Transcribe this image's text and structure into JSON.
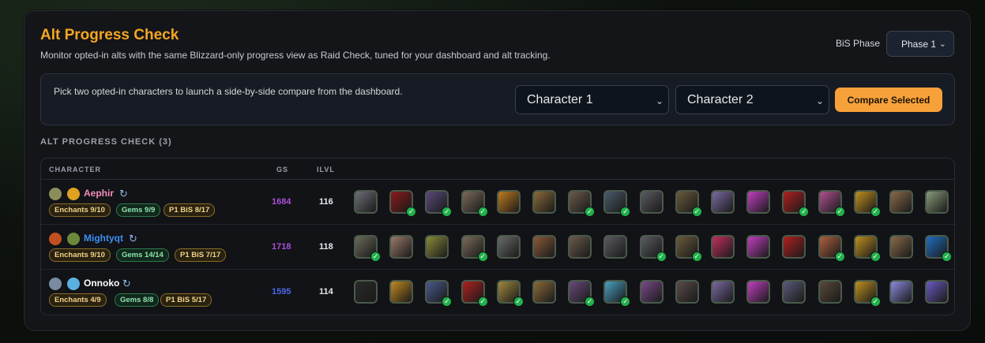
{
  "header": {
    "title": "Alt Progress Check",
    "subtitle": "Monitor opted-in alts with the same Blizzard-only progress view as Raid Check, tuned for your dashboard and alt tracking.",
    "phase_label": "BiS Phase",
    "phase_value": "Phase 1"
  },
  "compare": {
    "text": "Pick two opted-in characters to launch a side-by-side compare from the dashboard.",
    "char1": "Character 1",
    "char2": "Character 2",
    "button": "Compare Selected"
  },
  "section_title": "ALT PROGRESS CHECK (3)",
  "table": {
    "headers": {
      "character": "CHARACTER",
      "gs": "GS",
      "ilvl": "ILVL"
    },
    "rows": [
      {
        "name": "Aephir",
        "name_color": "#f58cba",
        "icons": [
          "spec-icon-a",
          "spec-icon-b"
        ],
        "icon_colors": [
          "#8a8f5a",
          "#e0a020"
        ],
        "enchants": "Enchants 9/10",
        "gems": "Gems 9/9",
        "bis": "P1 BiS 8/17",
        "gs": "1684",
        "gs_color": "#a94fd6",
        "ilvl": "116",
        "slots": [
          {
            "c": "#6e6e78",
            "ok": false
          },
          {
            "c": "#8a1a1a",
            "ok": true
          },
          {
            "c": "#5a4a7a",
            "ok": true
          },
          {
            "c": "#7a6a5a",
            "ok": true
          },
          {
            "c": "#c07a20",
            "ok": false
          },
          {
            "c": "#8a6a3a",
            "ok": false
          },
          {
            "c": "#6a5a4a",
            "ok": true
          },
          {
            "c": "#4a5a6a",
            "ok": true
          },
          {
            "c": "#5a5a62",
            "ok": false
          },
          {
            "c": "#6a5a3a",
            "ok": true
          },
          {
            "c": "#7a6aa0",
            "ok": false
          },
          {
            "c": "#c040c0",
            "ok": false
          },
          {
            "c": "#b02020",
            "ok": true
          },
          {
            "c": "#b05090",
            "ok": true
          },
          {
            "c": "#c09020",
            "ok": true
          },
          {
            "c": "#8a6a4a",
            "ok": false
          },
          {
            "c": "#8a9a7a",
            "ok": false
          }
        ]
      },
      {
        "name": "Mightyqt",
        "name_color": "#3b8ff0",
        "icons": [
          "spec-icon-a",
          "spec-icon-b"
        ],
        "icon_colors": [
          "#c05020",
          "#6a8a3a"
        ],
        "enchants": "Enchants 9/10",
        "gems": "Gems 14/14",
        "bis": "P1 BiS 7/17",
        "gs": "1718",
        "gs_color": "#a94fd6",
        "ilvl": "118",
        "slots": [
          {
            "c": "#6a6a5a",
            "ok": true
          },
          {
            "c": "#9a7a6a",
            "ok": false
          },
          {
            "c": "#8a8a3a",
            "ok": false
          },
          {
            "c": "#7a6a5a",
            "ok": true
          },
          {
            "c": "#6a6a6a",
            "ok": false
          },
          {
            "c": "#8a5a3a",
            "ok": false
          },
          {
            "c": "#6a5a4a",
            "ok": false
          },
          {
            "c": "#5a5a62",
            "ok": false
          },
          {
            "c": "#5a5a62",
            "ok": true
          },
          {
            "c": "#6a5a3a",
            "ok": true
          },
          {
            "c": "#c03060",
            "ok": false
          },
          {
            "c": "#c040c0",
            "ok": false
          },
          {
            "c": "#b02020",
            "ok": false
          },
          {
            "c": "#b06040",
            "ok": true
          },
          {
            "c": "#c09020",
            "ok": true
          },
          {
            "c": "#8a6a4a",
            "ok": false
          },
          {
            "c": "#2070c0",
            "ok": true
          }
        ]
      },
      {
        "name": "Onnoko",
        "name_color": "#ffffff",
        "icons": [
          "spec-icon-a",
          "spec-icon-b"
        ],
        "icon_colors": [
          "#7a8aa0",
          "#5ab0e0"
        ],
        "enchants": "Enchants 4/9",
        "gems": "Gems 8/8",
        "bis": "P1 BiS 5/17",
        "gs": "1595",
        "gs_color": "#4a6ae8",
        "ilvl": "114",
        "slots": [
          {
            "c": "#2a2a2a",
            "ok": false
          },
          {
            "c": "#c08a20",
            "ok": false
          },
          {
            "c": "#4a5a8a",
            "ok": true
          },
          {
            "c": "#b02020",
            "ok": true
          },
          {
            "c": "#a08a40",
            "ok": true
          },
          {
            "c": "#8a6a3a",
            "ok": false
          },
          {
            "c": "#6a4a7a",
            "ok": true
          },
          {
            "c": "#4aa0c0",
            "ok": true
          },
          {
            "c": "#7a4a8a",
            "ok": false
          },
          {
            "c": "#5a4a4a",
            "ok": false
          },
          {
            "c": "#7a6aa0",
            "ok": false
          },
          {
            "c": "#c040c0",
            "ok": false
          },
          {
            "c": "#5a5a7a",
            "ok": false
          },
          {
            "c": "#5a4a3a",
            "ok": false
          },
          {
            "c": "#c09020",
            "ok": true
          },
          {
            "c": "#8a8ae0",
            "ok": false
          },
          {
            "c": "#6a5ac0",
            "ok": false
          }
        ]
      }
    ]
  }
}
